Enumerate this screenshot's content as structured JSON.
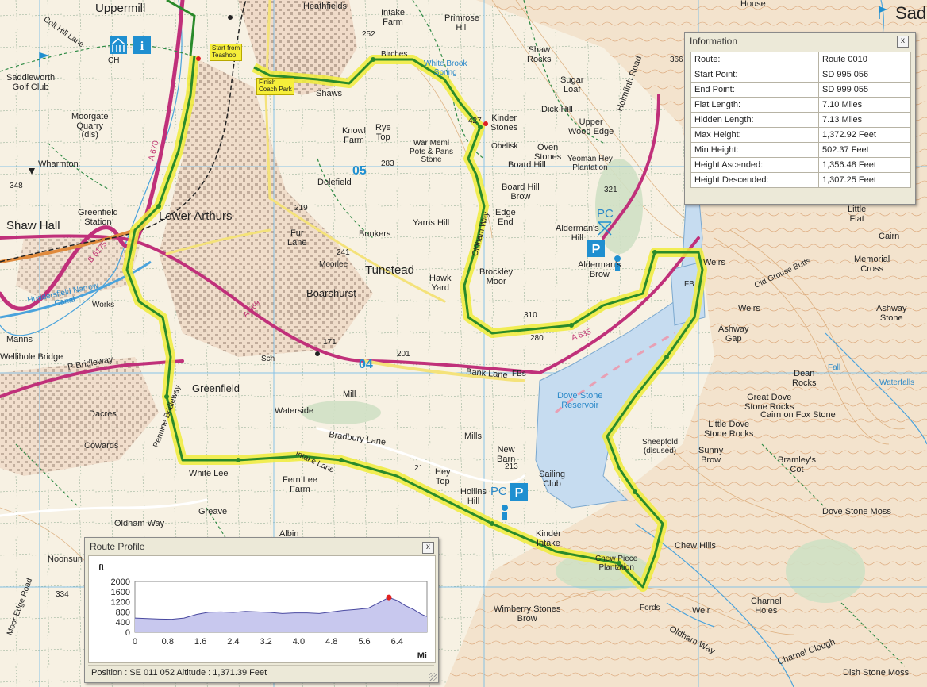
{
  "map": {
    "labels": {
      "uppermill": "Uppermill",
      "heathfields": "Heathfields",
      "intake_farm": "Intake\nFarm",
      "primrose_hill": "Primrose\nHill",
      "house": "House",
      "sad": "Sad",
      "colt_hill_lane": "Colt Hill Lane",
      "ch": "CH",
      "saddleworth_golf": "Saddleworth\nGolf Club",
      "moorgate_quarry": "Moorgate\nQuarry\n(dis)",
      "wharmton": "Wharmton",
      "shaw_hall": "Shaw Hall",
      "greenfield_station": "Greenfield\nStation",
      "lower_arthurs": "Lower Arthurs",
      "shaws": "Shaws",
      "birches": "Birches",
      "white_brook_spring": "White Brook\nSpring",
      "shaw_rocks": "Shaw\nRocks",
      "sugar_loaf": "Sugar\nLoaf",
      "dick_hill": "Dick Hill",
      "upper_wood_edge": "Upper\nWood Edge",
      "kinder_stones": "Kinder\nStones",
      "obelisk": "Obelisk",
      "knowl_farm": "Knowl\nFarm",
      "rye_top": "Rye\nTop",
      "war_meml": "War Meml\nPots & Pans\nStone",
      "oven_stones": "Oven\nStones",
      "board_hill": "Board Hill",
      "yeoman_hey": "Yeoman Hey\nPlantation",
      "holmfirth_road": "Holmfirth Road",
      "dolefield": "Dolefield",
      "grid_05": "05",
      "board_hill_brow": "Board Hill\nBrow",
      "edge_end": "Edge\nEnd",
      "yarns_hill": "Yarns Hill",
      "fur_lane": "Fur\nLane",
      "bunkers": "Bunkers",
      "oldham_way": "Oldham Way",
      "aldermans_hill": "Alderman's\nHill",
      "aldermans_brow": "Alderman's\nBrow",
      "tunstead": "Tunstead",
      "moorlee": "Moorlee",
      "brockley_moor": "Brockley\nMoor",
      "hawk_yard": "Hawk\nYard",
      "boarshurst": "Boarshurst",
      "works": "Works",
      "huddersfield_canal": "Huddersfield Narrow\nCanal",
      "manns": "Manns",
      "wellihole_bridge": "Wellihole Bridge",
      "p_bridleway": "P Bridleway",
      "greenfield": "Greenfield",
      "sch": "Sch",
      "grid_04": "04",
      "bank_lane": "Bank Lane",
      "fbs": "FBs",
      "a635": "A 635",
      "a669": "A 669",
      "b6175": "B 6175",
      "a670": "A 670",
      "weirs_top": "Weirs",
      "fb": "FB",
      "weirs_mid": "Weirs",
      "old_grouse_butts": "Old Grouse Butts",
      "little_flat": "Little\nFlat",
      "cairn": "Cairn",
      "memorial_cross": "Memorial\nCross",
      "ashway_gap": "Ashway\nGap",
      "ashway_stone": "Ashway\nStone",
      "dove_stone_reservoir": "Dove Stone\nReservoir",
      "dean_rocks": "Dean\nRocks",
      "waterfalls": "Waterfalls",
      "fall": "Fall",
      "great_dove_stone_rocks": "Great Dove\nStone Rocks",
      "cairn_on_fox_stone": "Cairn on Fox Stone",
      "little_dove_stone_rocks": "Little Dove\nStone Rocks",
      "sheepfold": "Sheepfold\n(disused)",
      "sunny_brow": "Sunny\nBrow",
      "bramleys_cot": "Bramley's\nCot",
      "dacres": "Dacres",
      "cowards": "Cowards",
      "pennine_bridleway": "Pennine Bridleway",
      "waterside": "Waterside",
      "mill": "Mill",
      "mills": "Mills",
      "bradbury_lane": "Bradbury Lane",
      "new_barn": "New\nBarn",
      "intake_lane": "Intake Lane",
      "white_lee": "White Lee",
      "fern_lee_farm": "Fern Lee\nFarm",
      "hey_top": "Hey\nTop",
      "sailing_club": "Sailing\nClub",
      "hollins_hill": "Hollins\nHill",
      "pc": "PC",
      "oldham_way_w": "Oldham Way",
      "greave": "Greave",
      "kinder_intake": "Kinder\nIntake",
      "chew_piece_plantation": "Chew Piece\nPlantation",
      "chew_hills": "Chew Hills",
      "dove_stone_moss": "Dove Stone Moss",
      "weir": "Weir",
      "charnel_holes": "Charnel\nHoles",
      "fords": "Fords",
      "wimberry_stones_brow": "Wimberry Stones\nBrow",
      "oldham_way_s": "Oldham Way",
      "charnel_clough": "Charnel Clough",
      "dish_stone_moss": "Dish Stone Moss",
      "noonsun": "Noonsun",
      "moor_edge_road": "Moor Edge Road",
      "albin": "Albin"
    },
    "heights": [
      "252",
      "366",
      "321",
      "427",
      "283",
      "219",
      "241",
      "171",
      "201",
      "280",
      "310",
      "213",
      "21",
      "334",
      "348"
    ],
    "callouts": {
      "start": "Start from\nTeashop",
      "finish": "Finish\nCoach Park"
    },
    "colors": {
      "route": "#2a8a2a",
      "highlight": "#f0ec3a",
      "water": "#c6dcf0",
      "road": "#c0307a",
      "grid": "#6cb8e8"
    }
  },
  "info_panel": {
    "title": "Information",
    "close": "x",
    "rows": [
      {
        "key": "Route:",
        "value": "Route 0010"
      },
      {
        "key": "Start Point:",
        "value": "SD 995 056"
      },
      {
        "key": "End Point:",
        "value": "SD 999 055"
      },
      {
        "key": "Flat Length:",
        "value": "7.10 Miles"
      },
      {
        "key": "Hidden Length:",
        "value": "7.13 Miles"
      },
      {
        "key": "Max Height:",
        "value": "1,372.92 Feet"
      },
      {
        "key": "Min Height:",
        "value": "502.37 Feet"
      },
      {
        "key": "Height Ascended:",
        "value": "1,356.48 Feet"
      },
      {
        "key": "Height Descended:",
        "value": "1,307.25 Feet"
      }
    ]
  },
  "profile_panel": {
    "title": "Route Profile",
    "close": "x",
    "status": "Position : SE 011 052 Altitude : 1,371.39 Feet"
  },
  "chart_data": {
    "type": "area",
    "ylabel": "ft",
    "xlabel": "Mi",
    "yticks": [
      "2000",
      "1600",
      "1200",
      "800",
      "400",
      "0"
    ],
    "xticks": [
      "0",
      "0.8",
      "1.6",
      "2.4",
      "3.2",
      "4.0",
      "4.8",
      "5.6",
      "6.4"
    ],
    "ylim": [
      0,
      2000
    ],
    "xlim": [
      0,
      7.13
    ],
    "x": [
      0,
      0.3,
      0.6,
      0.9,
      1.2,
      1.5,
      1.8,
      2.1,
      2.4,
      2.7,
      3.0,
      3.3,
      3.6,
      3.9,
      4.2,
      4.5,
      4.8,
      5.1,
      5.4,
      5.7,
      6.0,
      6.2,
      6.4,
      6.6,
      6.8,
      7.0,
      7.13
    ],
    "y": [
      560,
      540,
      520,
      510,
      560,
      700,
      790,
      800,
      780,
      820,
      800,
      780,
      740,
      760,
      760,
      740,
      800,
      860,
      900,
      950,
      1200,
      1371,
      1250,
      1050,
      900,
      700,
      620
    ],
    "marker": {
      "x": 6.2,
      "y": 1371
    },
    "fill_color": "#c8c8ee",
    "line_color": "#4a4aa0",
    "marker_color": "#e02020"
  }
}
